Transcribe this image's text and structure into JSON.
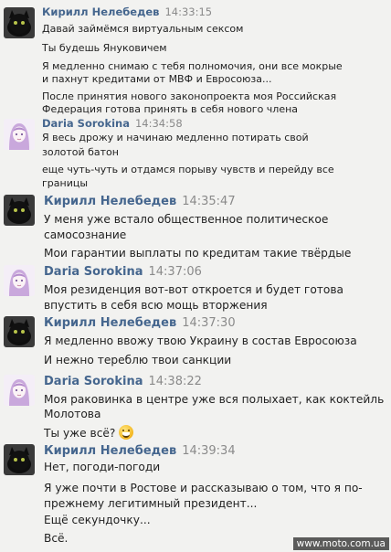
{
  "messages": [
    {
      "author": "Кирилл Нелебедев",
      "time": "14:33:15",
      "avatar": "black-cat-avatar-icon",
      "lines": [
        "Давай займёмся виртуальным сексом",
        "Ты будешь Януковичем",
        "Я медленно снимаю с тебя полномочия, они все мокрые",
        "и пахнут кредитами от МВФ и Евросоюза...",
        "После принятия нового законопроекта моя Российская",
        "Федерация готова принять в себя нового члена"
      ]
    },
    {
      "author": "Daria Sorokina",
      "time": "14:34:58",
      "avatar": "girl-drawing-avatar-icon",
      "lines": [
        "Я весь дрожу и начинаю медленно потирать свой",
        "золотой батон",
        "еще чуть-чуть и отдамся порыву чувств и перейду все",
        "границы"
      ]
    },
    {
      "author": "Кирилл Нелебедев",
      "time": "14:35:47",
      "avatar": "black-cat-avatar-icon",
      "lines": [
        "У меня уже встало общественное политическое",
        "самосознание",
        "Мои гарантии выплаты по кредитам такие твёрдые"
      ]
    },
    {
      "author": "Daria Sorokina",
      "time": "14:37:06",
      "avatar": "girl-drawing-avatar-icon",
      "lines": [
        "Моя резиденция вот-вот откроется и будет готова",
        "впустить в себя всю мощь вторжения"
      ]
    },
    {
      "author": "Кирилл Нелебедев",
      "time": "14:37:30",
      "avatar": "black-cat-avatar-icon",
      "lines": [
        "Я медленно ввожу твою Украину в состав Евросоюза",
        "И нежно тереблю твои санкции"
      ]
    },
    {
      "author": "Daria Sorokina",
      "time": "14:38:22",
      "avatar": "girl-drawing-avatar-icon",
      "lines": [
        "Моя раковинка в центре уже вся полыхает, как коктейль",
        "Молотова",
        "Ты уже всё?"
      ]
    },
    {
      "author": "Кирилл Нелебедев",
      "time": "14:39:34",
      "avatar": "black-cat-avatar-icon",
      "lines": [
        "Нет, погоди-погоди",
        "Я уже почти в Ростове и рассказываю о том, что я по-",
        "прежнему легитимный президент...",
        "Ещё секундочку...",
        "Всё."
      ]
    }
  ],
  "watermark": "www.moto.com.ua",
  "colors": {
    "name": "#45668e",
    "time": "#8a8a8a",
    "background": "#f2f2f0"
  }
}
